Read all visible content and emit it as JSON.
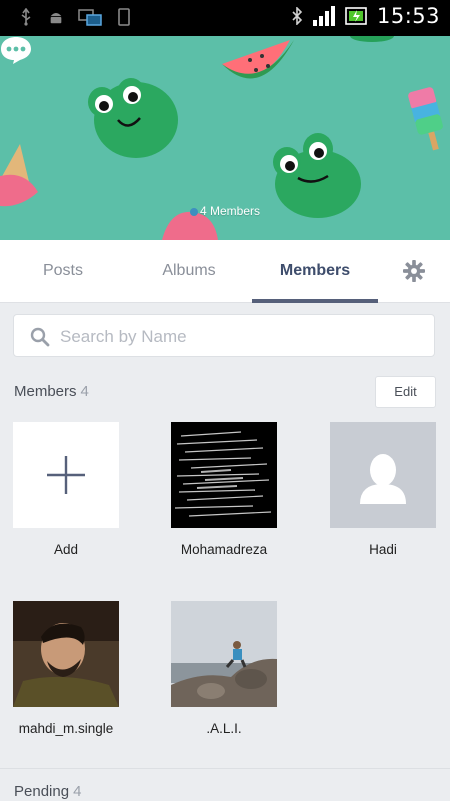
{
  "status_bar": {
    "time": "15:53",
    "icons": [
      "usb-icon",
      "android-icon",
      "pc-sync-icon",
      "device-icon",
      "bluetooth-icon",
      "signal-icon",
      "battery-icon"
    ]
  },
  "cover": {
    "member_count": "4 Members",
    "background_color": "#5cbfa8"
  },
  "tabs": [
    {
      "label": "Posts",
      "active": false
    },
    {
      "label": "Albums",
      "active": false
    },
    {
      "label": "Members",
      "active": true
    }
  ],
  "search": {
    "placeholder": "Search by Name",
    "value": ""
  },
  "members_section": {
    "title": "Members",
    "count": "4",
    "edit_label": "Edit",
    "items": [
      {
        "name": "Add",
        "kind": "add"
      },
      {
        "name": "Mohamadreza",
        "kind": "photo"
      },
      {
        "name": "Hadi",
        "kind": "placeholder"
      },
      {
        "name": "mahdi_m.single",
        "kind": "photo"
      },
      {
        "name": ".A.L.I.",
        "kind": "photo"
      }
    ]
  },
  "pending_section": {
    "title": "Pending",
    "count": "4"
  },
  "colors": {
    "accent": "#3e4d6c",
    "tab_indicator": "#56607a",
    "page_bg": "#ebedf0"
  }
}
